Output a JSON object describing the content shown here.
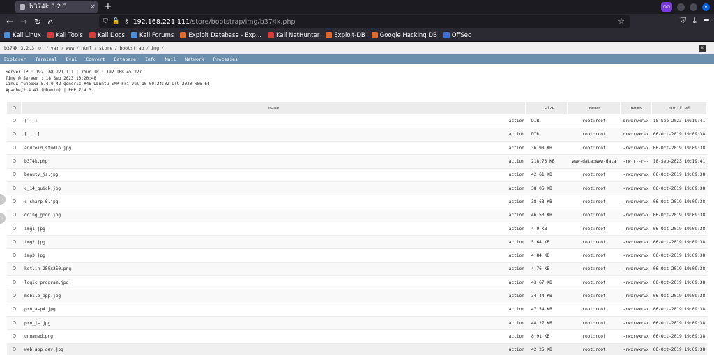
{
  "browser": {
    "tab_title": "b374k 3.2.3",
    "url_host": "192.168.221.111",
    "url_path": "/store/bootstrap/img/b374k.php",
    "bookmarks": [
      {
        "label": "Kali Linux",
        "color": "#4f8fd8"
      },
      {
        "label": "Kali Tools",
        "color": "#d83b3b"
      },
      {
        "label": "Kali Docs",
        "color": "#d83b3b"
      },
      {
        "label": "Kali Forums",
        "color": "#4f8fd8"
      },
      {
        "label": "Exploit Database - Exp...",
        "color": "#e06a2d"
      },
      {
        "label": "Kali NetHunter",
        "color": "#d83b3b"
      },
      {
        "label": "Exploit-DB",
        "color": "#e06a2d"
      },
      {
        "label": "Google Hacking DB",
        "color": "#e06a2d"
      },
      {
        "label": "OffSec",
        "color": "#3d6fd8"
      }
    ]
  },
  "shell": {
    "version": "b374k 3.2.3",
    "path": [
      "var",
      "www",
      "html",
      "store",
      "bootstrap",
      "img"
    ],
    "close_label": "x",
    "menu": [
      "Explorer",
      "Terminal",
      "Eval",
      "Convert",
      "Database",
      "Info",
      "Mail",
      "Network",
      "Processes"
    ],
    "info": {
      "line1": "Server IP : 192.168.221.111 | Your IP : 192.168.45.227",
      "line2": "Time @ Server : 18 Sep 2023 10:20:48",
      "line3": "Linux funbox3 5.4.0-42-generic #46-Ubuntu SMP Fri Jul 10 00:24:02 UTC 2020 x86_64",
      "line4": "Apache/2.4.41 (Ubuntu) | PHP 7.4.3"
    },
    "table": {
      "headers": {
        "name": "name",
        "size": "size",
        "owner": "owner",
        "perms": "perms",
        "modified": "modified"
      },
      "rows": [
        {
          "name": "[ . ]",
          "action": "action",
          "size": "DIR",
          "owner": "root:root",
          "perms": "drwxrwxrwx",
          "modified": "18-Sep-2023 10:19:41"
        },
        {
          "name": "[ .. ]",
          "action": "action",
          "size": "DIR",
          "owner": "root:root",
          "perms": "drwxrwxrwx",
          "modified": "06-Oct-2019 19:09:38"
        },
        {
          "name": "android_studio.jpg",
          "action": "action",
          "size": "36.98 KB",
          "owner": "root:root",
          "perms": "-rwxrwxrwx",
          "modified": "06-Oct-2019 19:09:38"
        },
        {
          "name": "b374k.php",
          "action": "action",
          "size": "218.73 KB",
          "owner": "www-data:www-data",
          "perms": "-rw-r--r--",
          "modified": "18-Sep-2023 10:19:41"
        },
        {
          "name": "beauty_js.jpg",
          "action": "action",
          "size": "42.61 KB",
          "owner": "root:root",
          "perms": "-rwxrwxrwx",
          "modified": "06-Oct-2019 19:09:38"
        },
        {
          "name": "c_14_quick.jpg",
          "action": "action",
          "size": "38.05 KB",
          "owner": "root:root",
          "perms": "-rwxrwxrwx",
          "modified": "06-Oct-2019 19:09:38"
        },
        {
          "name": "c_sharp_6.jpg",
          "action": "action",
          "size": "38.63 KB",
          "owner": "root:root",
          "perms": "-rwxrwxrwx",
          "modified": "06-Oct-2019 19:09:38"
        },
        {
          "name": "doing_good.jpg",
          "action": "action",
          "size": "46.53 KB",
          "owner": "root:root",
          "perms": "-rwxrwxrwx",
          "modified": "06-Oct-2019 19:09:38"
        },
        {
          "name": "img1.jpg",
          "action": "action",
          "size": "4.9 KB",
          "owner": "root:root",
          "perms": "-rwxrwxrwx",
          "modified": "06-Oct-2019 19:09:38"
        },
        {
          "name": "img2.jpg",
          "action": "action",
          "size": "5.64 KB",
          "owner": "root:root",
          "perms": "-rwxrwxrwx",
          "modified": "06-Oct-2019 19:09:38"
        },
        {
          "name": "img3.jpg",
          "action": "action",
          "size": "4.84 KB",
          "owner": "root:root",
          "perms": "-rwxrwxrwx",
          "modified": "06-Oct-2019 19:09:38"
        },
        {
          "name": "kotlin_250x250.png",
          "action": "action",
          "size": "4.76 KB",
          "owner": "root:root",
          "perms": "-rwxrwxrwx",
          "modified": "06-Oct-2019 19:09:38"
        },
        {
          "name": "logic_program.jpg",
          "action": "action",
          "size": "43.67 KB",
          "owner": "root:root",
          "perms": "-rwxrwxrwx",
          "modified": "06-Oct-2019 19:09:38"
        },
        {
          "name": "mobile_app.jpg",
          "action": "action",
          "size": "34.44 KB",
          "owner": "root:root",
          "perms": "-rwxrwxrwx",
          "modified": "06-Oct-2019 19:09:38"
        },
        {
          "name": "pro_asp4.jpg",
          "action": "action",
          "size": "47.54 KB",
          "owner": "root:root",
          "perms": "-rwxrwxrwx",
          "modified": "06-Oct-2019 19:09:38"
        },
        {
          "name": "pro_js.jpg",
          "action": "action",
          "size": "48.27 KB",
          "owner": "root:root",
          "perms": "-rwxrwxrwx",
          "modified": "06-Oct-2019 19:09:38"
        },
        {
          "name": "unnamed.png",
          "action": "action",
          "size": "8.91 KB",
          "owner": "root:root",
          "perms": "-rwxrwxrwx",
          "modified": "06-Oct-2019 19:09:38"
        },
        {
          "name": "web_app_dev.jpg",
          "action": "action",
          "size": "42.25 KB",
          "owner": "root:root",
          "perms": "-rwxrwxrwx",
          "modified": "06-Oct-2019 19:09:38"
        }
      ]
    }
  }
}
